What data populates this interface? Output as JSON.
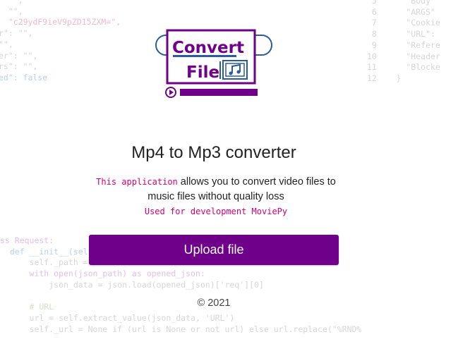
{
  "background_code": {
    "left_top": [
      "  \"\",",
      "  \"\",",
      "  \"c29ydF9ieV9pZD15ZXM=\",",
      "r\": \"\",",
      "\"\",",
      "er\": \"\",",
      "rs\": \"\",",
      "ed\": false"
    ],
    "right": [
      " 5      \"Body\"",
      " 6      \"ARGS\"",
      " 7      \"Cookie",
      " 8      \"URL\":",
      " 9      \"Refere",
      "10      \"Header",
      "11      \"Blocke",
      "12    }"
    ],
    "left_bottom": [
      "ss Request:",
      "  def __init__(self",
      "      self._path = ",
      "      with open(json_path) as opened_json:",
      "          json_data = json.load(opened_json)['req'][0]",
      "",
      "      # URL",
      "      url = self.extract_value(json_data, 'URL')",
      "      self._url = None if (url is None or not url) else url.replace(\"%RND%"
    ]
  },
  "logo": {
    "line1": "Convert",
    "line2": "File",
    "alt": "Convert File logo"
  },
  "main": {
    "title": "Mp4 to Mp3 converter",
    "desc_highlight": "This application",
    "desc_rest": " allows you to convert video files to music files without quality loss",
    "credit": "Used for development MoviePy",
    "upload_label": "Upload file",
    "footer": "© 2021"
  },
  "colors": {
    "brand_purple": "#6f008a",
    "accent_pink": "#d6006e",
    "logo_blue": "#2c5aa0"
  }
}
